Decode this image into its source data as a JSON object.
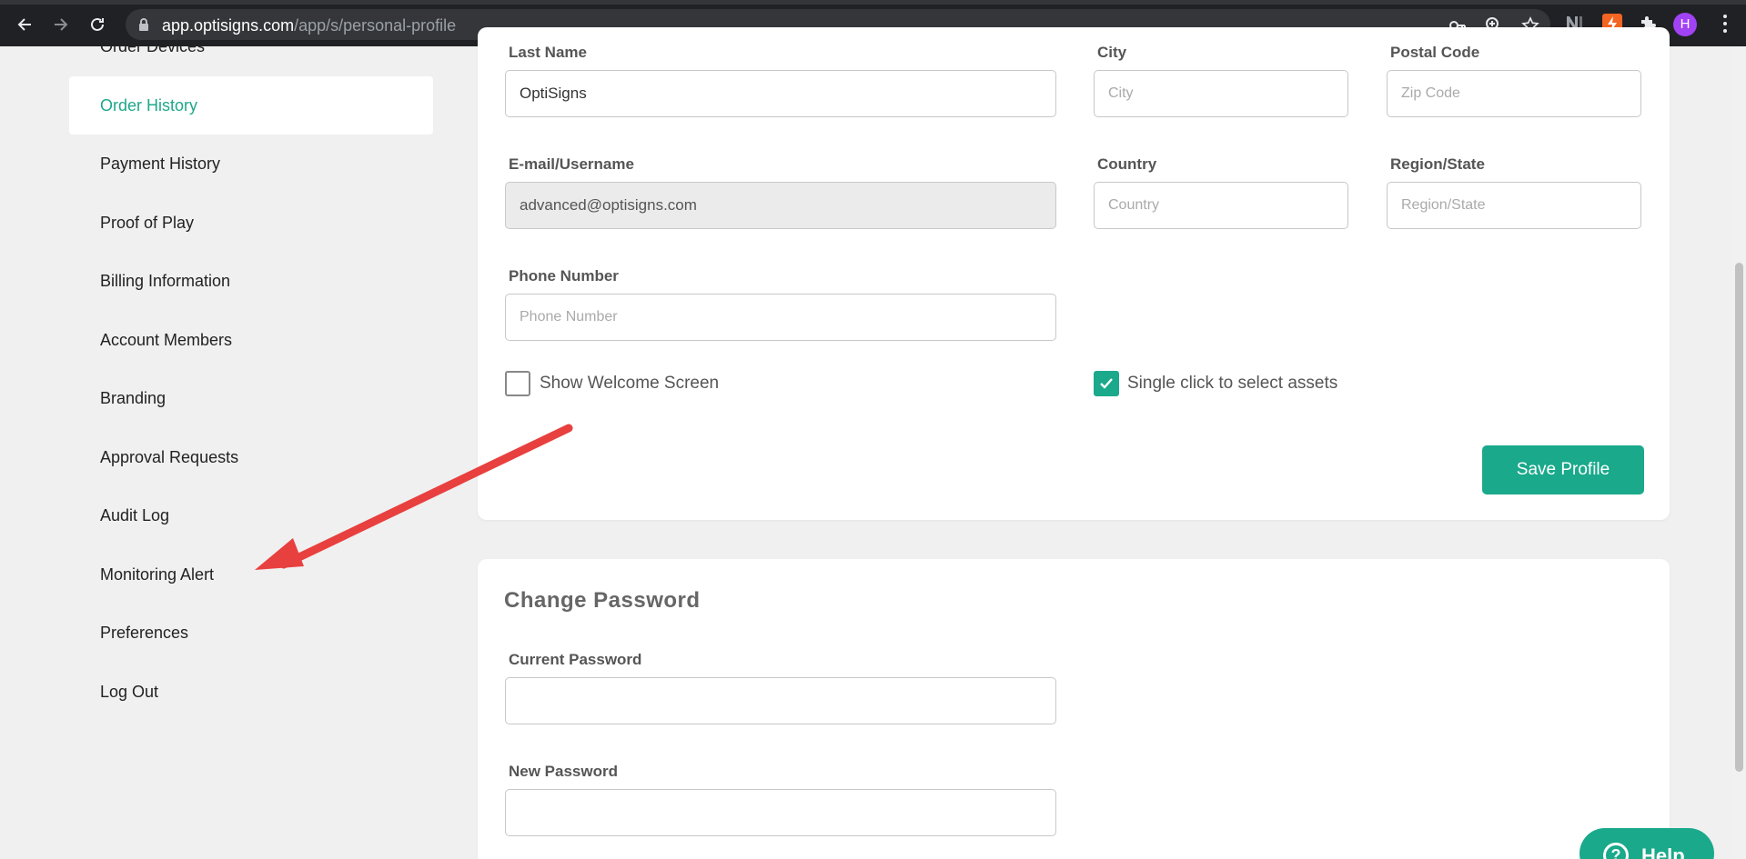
{
  "browser": {
    "url_host": "app.optisigns.com",
    "url_path": "/app/s/personal-profile",
    "avatar_letter": "H",
    "icons": [
      "back-icon",
      "forward-icon",
      "reload-icon",
      "lock-icon",
      "key-icon",
      "zoom-icon",
      "star-icon",
      "extension-n-icon",
      "extension-bolt-icon",
      "puzzle-icon",
      "menu-icon"
    ]
  },
  "sidebar": {
    "items": [
      {
        "label": "Order Devices"
      },
      {
        "label": "Order History"
      },
      {
        "label": "Payment History"
      },
      {
        "label": "Proof of Play"
      },
      {
        "label": "Billing Information"
      },
      {
        "label": "Account Members"
      },
      {
        "label": "Branding"
      },
      {
        "label": "Approval Requests"
      },
      {
        "label": "Audit Log"
      },
      {
        "label": "Monitoring Alert"
      },
      {
        "label": "Preferences"
      },
      {
        "label": "Log Out"
      }
    ],
    "active": "Order History"
  },
  "profile": {
    "last_name_label": "Last Name",
    "last_name_value": "OptiSigns",
    "city_label": "City",
    "city_placeholder": "City",
    "postal_label": "Postal Code",
    "postal_placeholder": "Zip Code",
    "email_label": "E-mail/Username",
    "email_value": "advanced@optisigns.com",
    "country_label": "Country",
    "country_placeholder": "Country",
    "region_label": "Region/State",
    "region_placeholder": "Region/State",
    "phone_label": "Phone Number",
    "phone_placeholder": "Phone Number",
    "welcome_label": "Show Welcome Screen",
    "welcome_checked": false,
    "single_click_label": "Single click to select assets",
    "single_click_checked": true,
    "save_label": "Save Profile"
  },
  "password": {
    "title": "Change Password",
    "current_label": "Current Password",
    "new_label": "New Password"
  },
  "help": {
    "label": "Help"
  },
  "colors": {
    "accent": "#1aa98b",
    "annotation_arrow": "#e8403f",
    "chrome_bg": "#202124"
  }
}
